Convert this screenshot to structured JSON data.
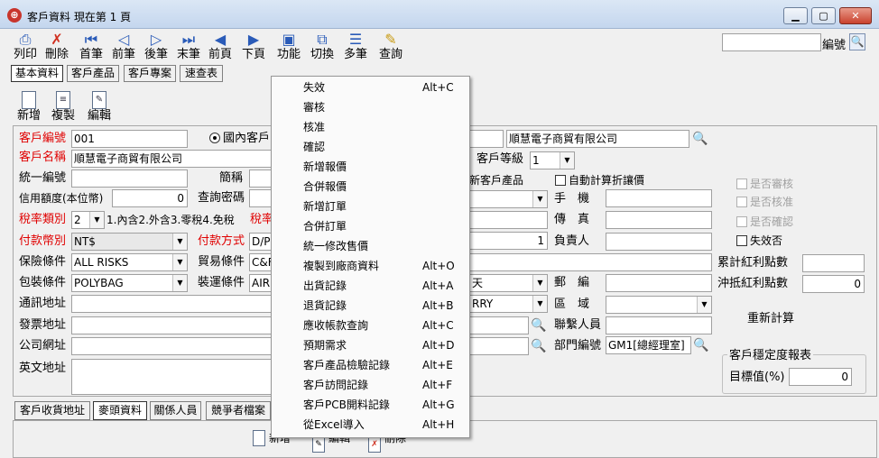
{
  "window": {
    "title": "客戶資料 現在第 1 頁",
    "minimize": "▁",
    "maximize": "▢",
    "close": "✕"
  },
  "toolbar": [
    {
      "label": "列印",
      "icon": "printer-icon"
    },
    {
      "label": "刪除",
      "icon": "delete-icon"
    },
    {
      "label": "首筆",
      "icon": "first-record-icon"
    },
    {
      "label": "前筆",
      "icon": "previous-record-icon"
    },
    {
      "label": "後筆",
      "icon": "next-record-icon"
    },
    {
      "label": "末筆",
      "icon": "last-record-icon"
    },
    {
      "label": "前頁",
      "icon": "previous-page-icon"
    },
    {
      "label": "下頁",
      "icon": "next-page-icon"
    },
    {
      "label": "功能",
      "icon": "function-icon"
    },
    {
      "label": "切換",
      "icon": "switch-icon"
    },
    {
      "label": "多筆",
      "icon": "multi-record-icon"
    },
    {
      "label": "查詢",
      "icon": "query-icon"
    }
  ],
  "search": {
    "value": "",
    "label": "編號"
  },
  "tabs": [
    "基本資料",
    "客戶產品",
    "客戶專案",
    "速查表"
  ],
  "subtoolbar": [
    "新增",
    "複製",
    "編輯"
  ],
  "form": {
    "customer_no_label": "客戶編號",
    "customer_no": "001",
    "domestic_radio": "國內客戶",
    "customer_name_label": "客戶名稱",
    "customer_name": "順慧電子商貿有限公司",
    "customer_fullname_right": "順慧電子商貿有限公司",
    "customer_level_label": "客戶等級",
    "customer_level": "1",
    "tax_id_label": "統一編號",
    "short_name_label": "簡稱",
    "new_customer_product": "新客戶產品",
    "auto_discount": "自動計算折讓價",
    "credit_label": "信用額度(本位幣)",
    "credit_value": "0",
    "query_pw_label": "查詢密碼",
    "mobile_label": "手　機",
    "tax_type_label": "稅率類別",
    "tax_type": "2",
    "tax_hint": "1.內含2.外含3.零稅4.免稅",
    "tax_rate_label": "稅率",
    "fax_label": "傳　真",
    "currency_label": "付款幣別",
    "currency": "NT$",
    "payment_label": "付款方式",
    "payment": "D/P",
    "payment_num": "1",
    "person_label": "負責人",
    "insurance_label": "保險條件",
    "insurance": "ALL RISKS",
    "trade_label": "貿易條件",
    "trade": "C&F",
    "packing_label": "包裝條件",
    "packing": "POLYBAG",
    "shipping_label": "裝運條件",
    "shipping": "AIR",
    "shipping_right": "天",
    "zip_label": "郵　編",
    "contact_addr_label": "通訊地址",
    "carry_value": "RRY",
    "region_label": "區　域",
    "invoice_addr_label": "發票地址",
    "contact_person_label": "聯繫人員",
    "website_label": "公司網址",
    "dept_label": "部門編號",
    "dept": "GM1[總經理室]",
    "english_addr_label": "英文地址",
    "is_audit": "是否審核",
    "is_approve": "是否核准",
    "is_confirm": "是否確認",
    "invalid": "失效否",
    "bonus_total_label": "累計紅利點數",
    "bonus_offset_label": "沖抵紅利點數",
    "bonus_offset": "0",
    "recalc_button": "重新計算",
    "stability_group": "客戶穩定度報表",
    "target_label": "目標值(%)",
    "target_value": "0"
  },
  "bottom_tabs": [
    "客戶收貨地址",
    "麥頭資料",
    "關係人員",
    "競爭者檔案"
  ],
  "bottom_toolbar": [
    "新增",
    "編輯",
    "刪除"
  ],
  "context_menu": [
    {
      "label": "失效",
      "shortcut": "Alt+C"
    },
    {
      "label": "審核",
      "shortcut": ""
    },
    {
      "label": "核准",
      "shortcut": ""
    },
    {
      "label": "確認",
      "shortcut": ""
    },
    {
      "label": "新增報價",
      "shortcut": ""
    },
    {
      "label": "合併報價",
      "shortcut": ""
    },
    {
      "label": "新增訂單",
      "shortcut": ""
    },
    {
      "label": "合併訂單",
      "shortcut": ""
    },
    {
      "label": "統一修改售價",
      "shortcut": ""
    },
    {
      "label": "複製到廠商資料",
      "shortcut": "Alt+O"
    },
    {
      "label": "出貨記錄",
      "shortcut": "Alt+A"
    },
    {
      "label": "退貨記錄",
      "shortcut": "Alt+B"
    },
    {
      "label": "應收帳款查詢",
      "shortcut": "Alt+C"
    },
    {
      "label": "預期需求",
      "shortcut": "Alt+D"
    },
    {
      "label": "客戶產品檢驗記錄",
      "shortcut": "Alt+E"
    },
    {
      "label": "客戶訪問記錄",
      "shortcut": "Alt+F"
    },
    {
      "label": "客戶PCB開料記錄",
      "shortcut": "Alt+G"
    },
    {
      "label": "從Excel導入",
      "shortcut": "Alt+H"
    }
  ]
}
